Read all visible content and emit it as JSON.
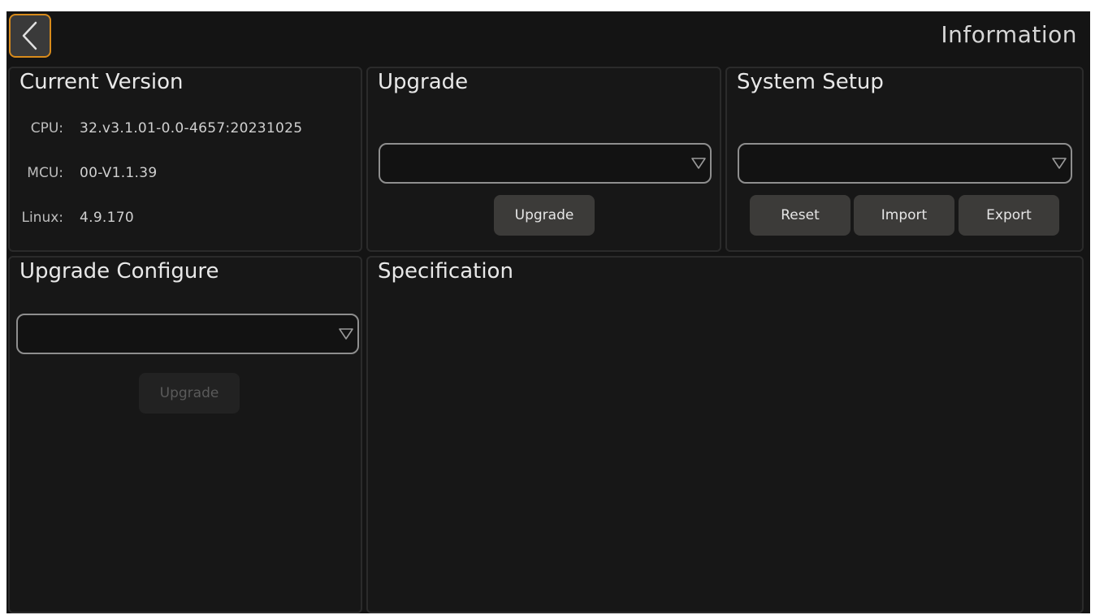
{
  "header": {
    "title": "Information",
    "back_icon": "chevron-left-icon",
    "accent_color": "#d88b1c"
  },
  "current_version": {
    "title": "Current Version",
    "rows": [
      {
        "label": "CPU:",
        "value": "32.v3.1.01-0.0-4657:20231025"
      },
      {
        "label": "MCU:",
        "value": "00-V1.1.39"
      },
      {
        "label": "Linux:",
        "value": "4.9.170"
      }
    ]
  },
  "upgrade": {
    "title": "Upgrade",
    "select_value": "",
    "button_label": "Upgrade"
  },
  "system_setup": {
    "title": "System Setup",
    "select_value": "",
    "reset_label": "Reset",
    "import_label": "Import",
    "export_label": "Export"
  },
  "upgrade_configure": {
    "title": "Upgrade Configure",
    "select_value": "",
    "button_label": "Upgrade",
    "button_enabled": false
  },
  "specification": {
    "title": "Specification"
  }
}
